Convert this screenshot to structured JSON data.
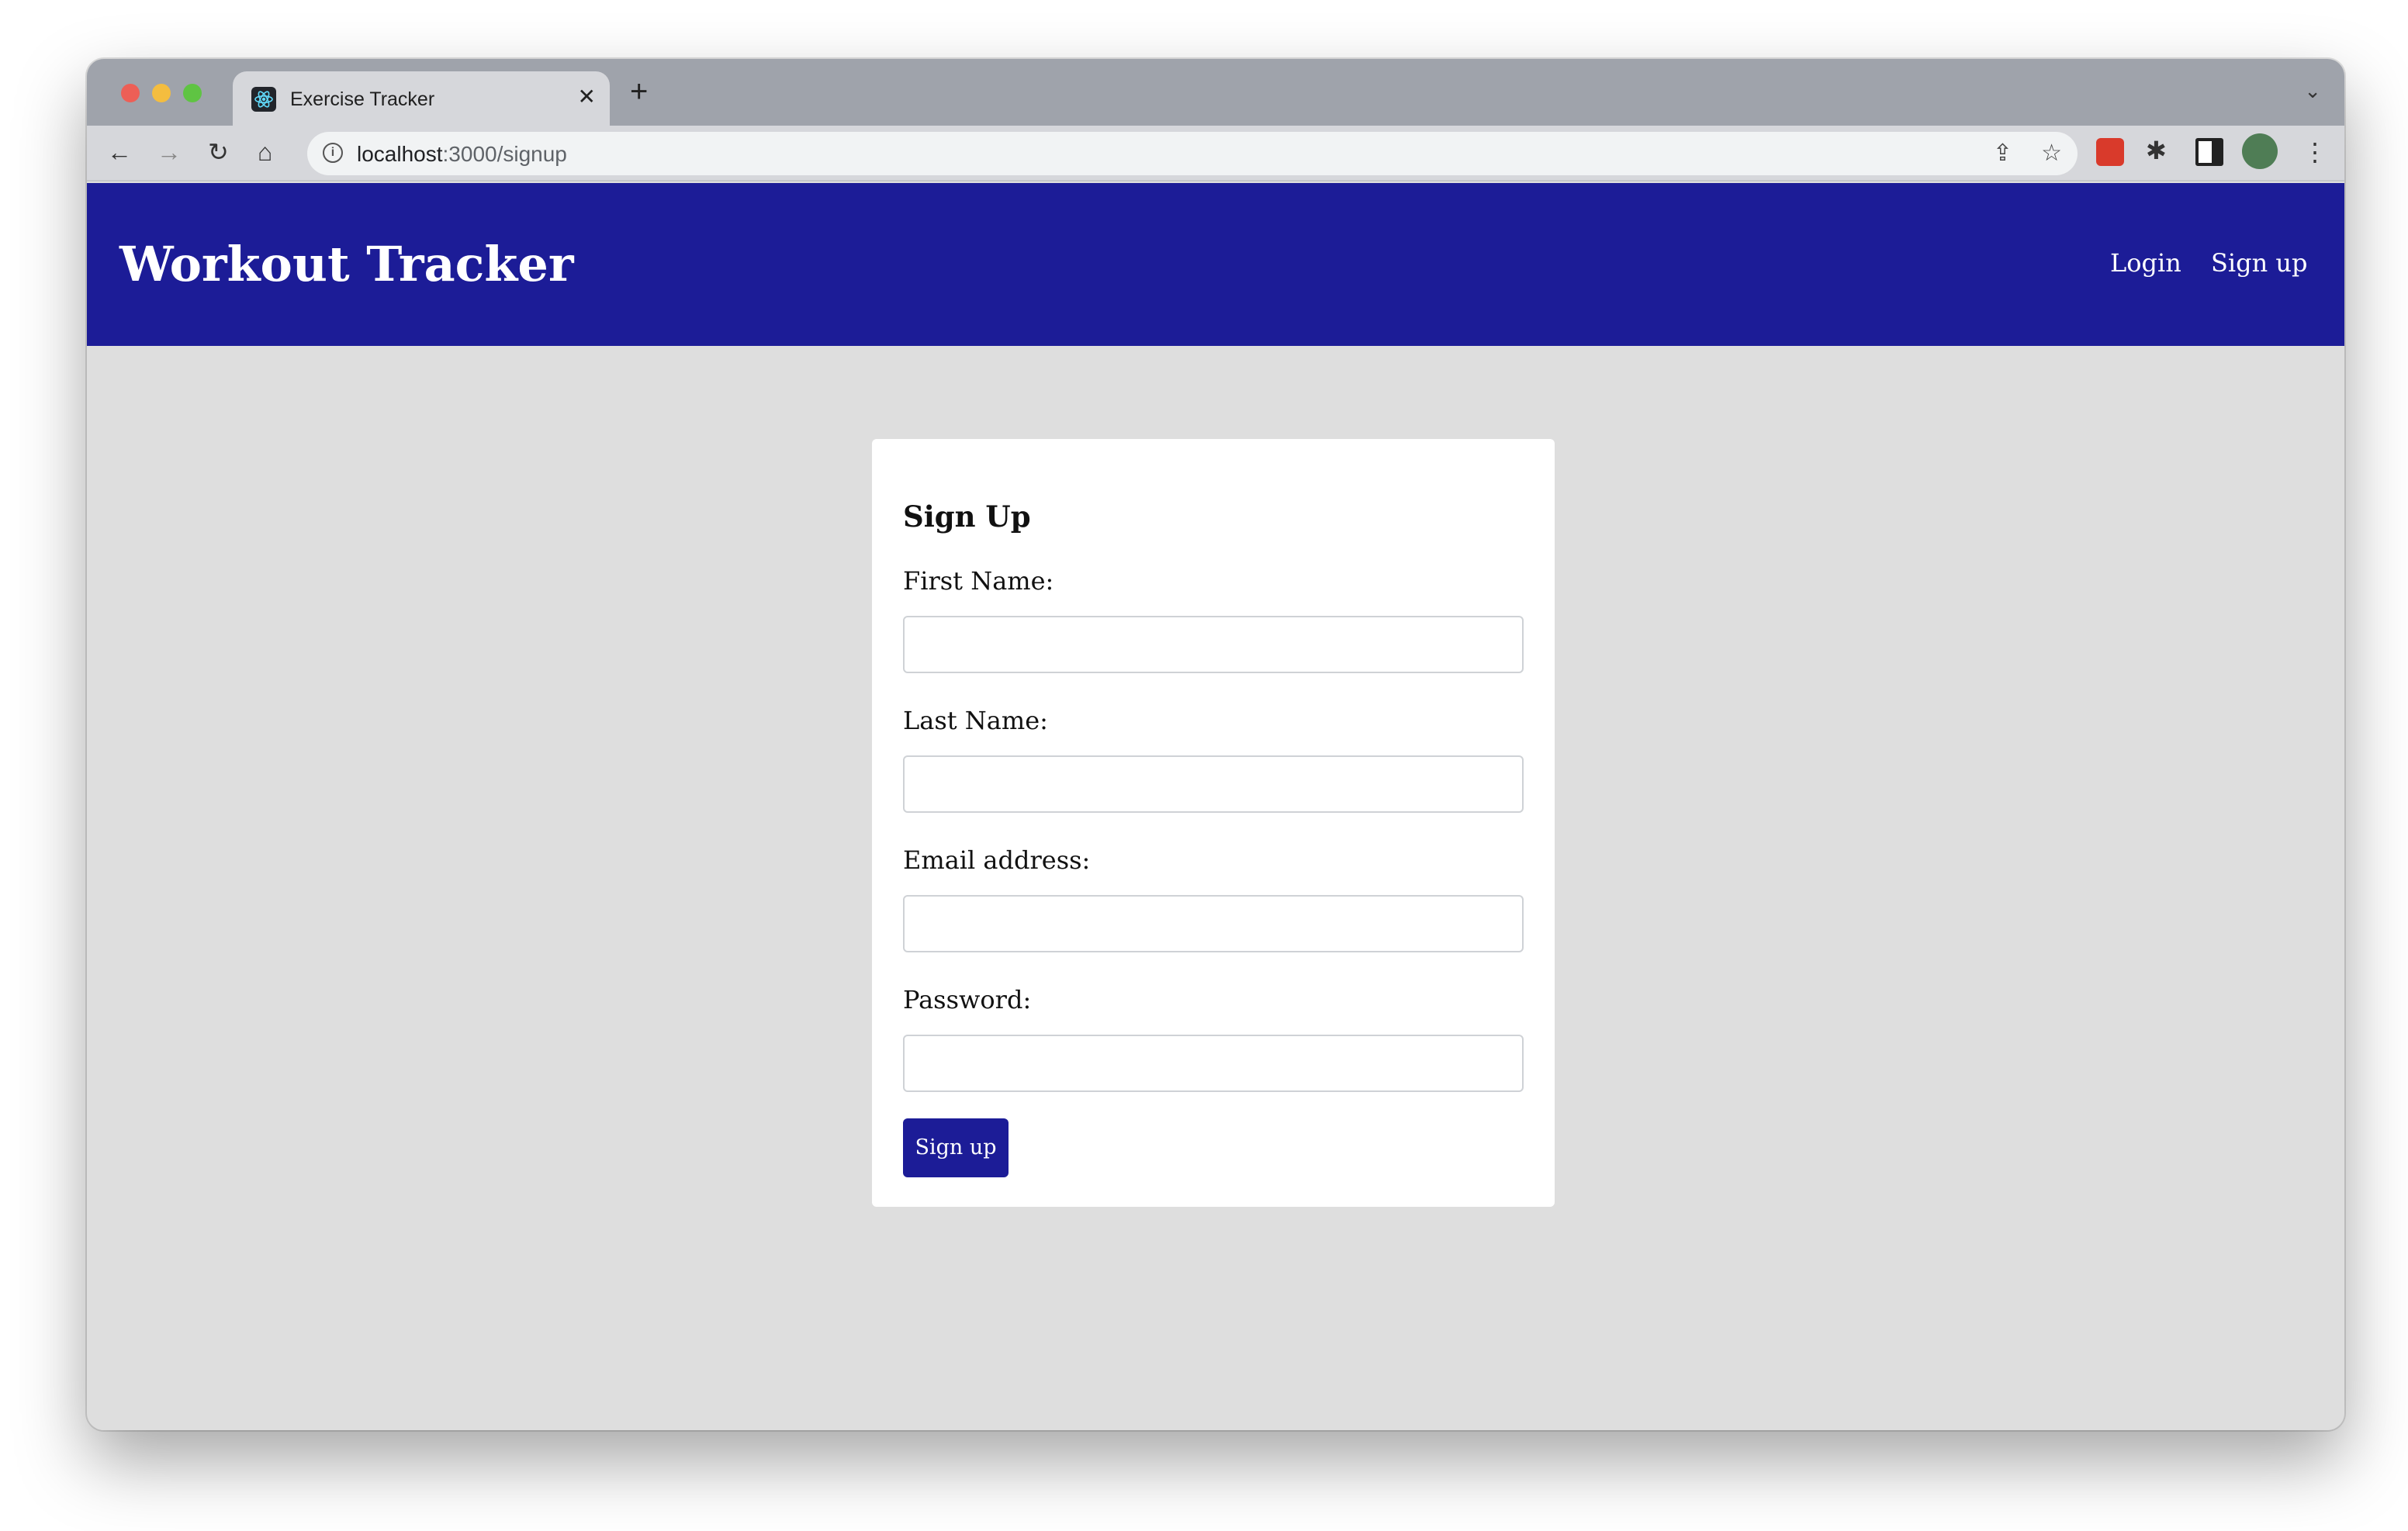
{
  "browser": {
    "tab_title": "Exercise Tracker",
    "tab_close": "✕",
    "new_tab": "+",
    "tab_list": "⌄",
    "back": "←",
    "forward": "→",
    "reload": "↻",
    "home": "⌂",
    "url_host": "localhost",
    "url_path": ":3000/signup",
    "share": "⇪",
    "bookmark": "☆",
    "extensions": "✱",
    "menu": "⋮"
  },
  "navbar": {
    "brand": "Workout Tracker",
    "login": "Login",
    "signup": "Sign up",
    "color": "#1c1c97"
  },
  "form": {
    "title": "Sign Up",
    "first_name_label": "First Name:",
    "first_name_value": "",
    "last_name_label": "Last Name:",
    "last_name_value": "",
    "email_label": "Email address:",
    "email_value": "",
    "password_label": "Password:",
    "password_value": "",
    "submit": "Sign up"
  }
}
